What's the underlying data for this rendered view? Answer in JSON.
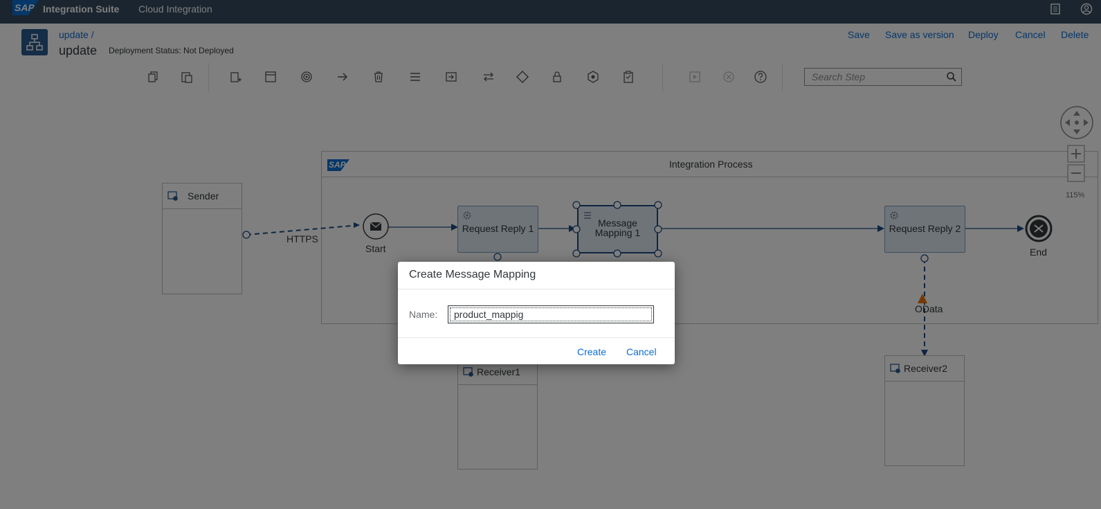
{
  "shell": {
    "logo": "SAP",
    "product": "Integration Suite",
    "app": "Cloud Integration"
  },
  "header": {
    "breadcrumb": "update /",
    "title": "update",
    "deployment_status": "Deployment Status: Not Deployed",
    "actions": {
      "save": "Save",
      "save_as_version": "Save as version",
      "deploy": "Deploy",
      "cancel": "Cancel",
      "delete": "Delete"
    }
  },
  "toolbar": {
    "search_placeholder": "Search Step"
  },
  "canvas": {
    "zoom": "115%",
    "sender": "Sender",
    "integration_process": "Integration Process",
    "pool_logo": "SAP",
    "sender_channel": "HTTPS",
    "start_label": "Start",
    "end_label": "End",
    "request_reply_1": "Request Reply 1",
    "message_mapping_1": "Message Mapping 1",
    "request_reply_2": "Request Reply 2",
    "odata_channel": "OData",
    "receiver1": "Receiver1",
    "receiver2": "Receiver2"
  },
  "dialog": {
    "title": "Create Message Mapping",
    "name_label": "Name:",
    "name_value": "product_mappig",
    "create": "Create",
    "cancel": "Cancel"
  },
  "colors": {
    "shell": "#354a5f",
    "accent": "#0a6ed1",
    "task_fill": "#dfe8f2",
    "warning": "#e9730c"
  }
}
